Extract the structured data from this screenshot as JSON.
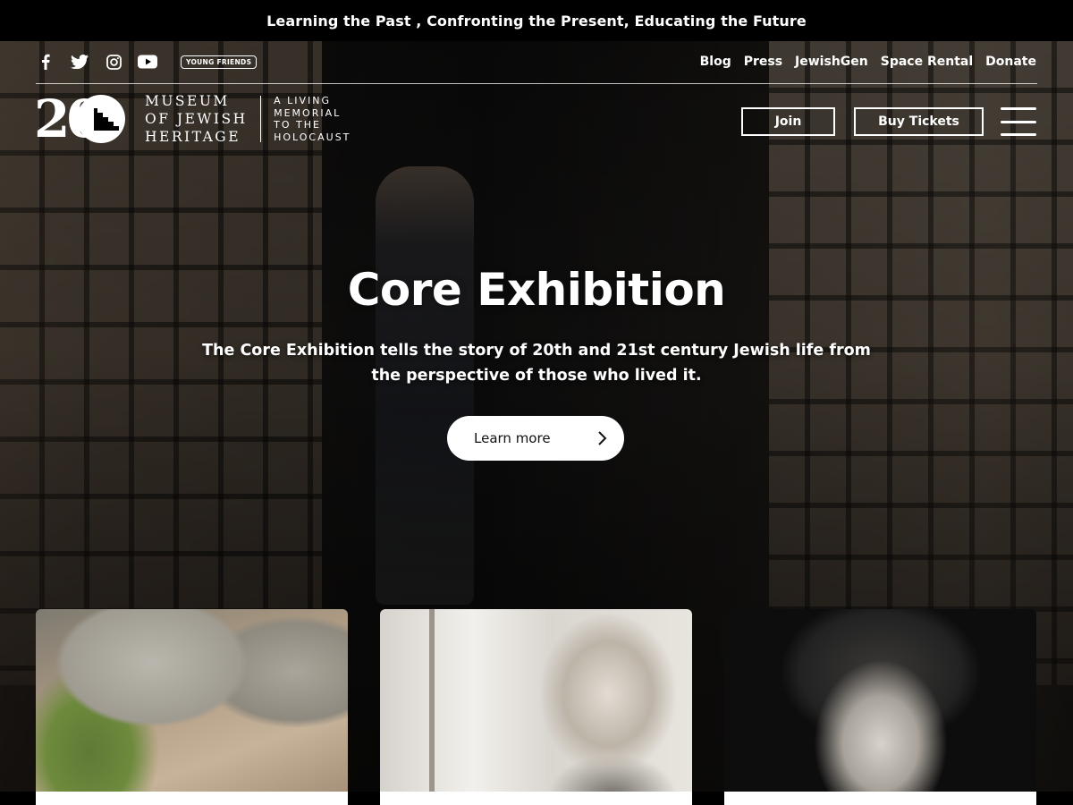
{
  "topbar": {
    "tagline": "Learning the Past , Confronting the Present, Educating the Future"
  },
  "social": {
    "icons": [
      "facebook-icon",
      "twitter-icon",
      "instagram-icon",
      "youtube-icon"
    ],
    "badge": "YOUNG FRIENDS"
  },
  "toplinks": [
    "Blog",
    "Press",
    "JewishGen",
    "Space Rental",
    "Donate"
  ],
  "logo": {
    "number": "20",
    "name_lines": [
      "MUSEUM",
      "OF JEWISH",
      "HERITAGE"
    ],
    "tag_lines": [
      "A LIVING",
      "MEMORIAL",
      "TO THE",
      "HOLOCAUST"
    ]
  },
  "header": {
    "join_label": "Join",
    "tickets_label": "Buy Tickets",
    "menu_icon": "hamburger-icon"
  },
  "hero": {
    "title": "Core Exhibition",
    "description": "The Core Exhibition tells the story of 20th and 21st century Jewish life from the perspective of those who lived it.",
    "cta_label": "Learn more",
    "cta_icon": "chevron-right-icon"
  },
  "colors": {
    "background": "#000000",
    "text": "#ffffff",
    "cta_bg": "#ffffff",
    "cta_text": "#111111"
  }
}
